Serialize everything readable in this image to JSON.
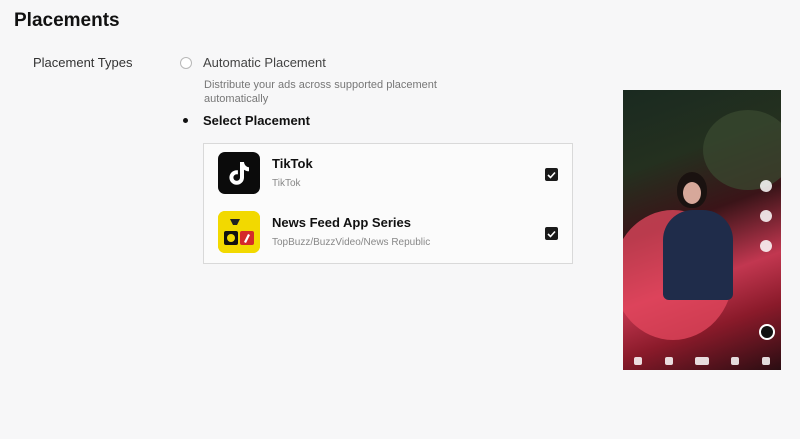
{
  "page": {
    "title": "Placements"
  },
  "placement_types": {
    "label": "Placement Types",
    "options": [
      {
        "label": "Automatic Placement",
        "description": "Distribute your ads across supported placement automatically",
        "selected": false
      },
      {
        "label": "Select Placement",
        "selected": true
      }
    ]
  },
  "placements": [
    {
      "name": "TikTok",
      "sub": "TikTok",
      "checked": true,
      "icon": "tiktok-logo-icon"
    },
    {
      "name": "News Feed App Series",
      "sub": "TopBuzz/BuzzVideo/News Republic",
      "checked": true,
      "icon": "news-feed-app-icon"
    }
  ],
  "colors": {
    "checkbox": "#1a1a1a",
    "accent": "#111111"
  }
}
